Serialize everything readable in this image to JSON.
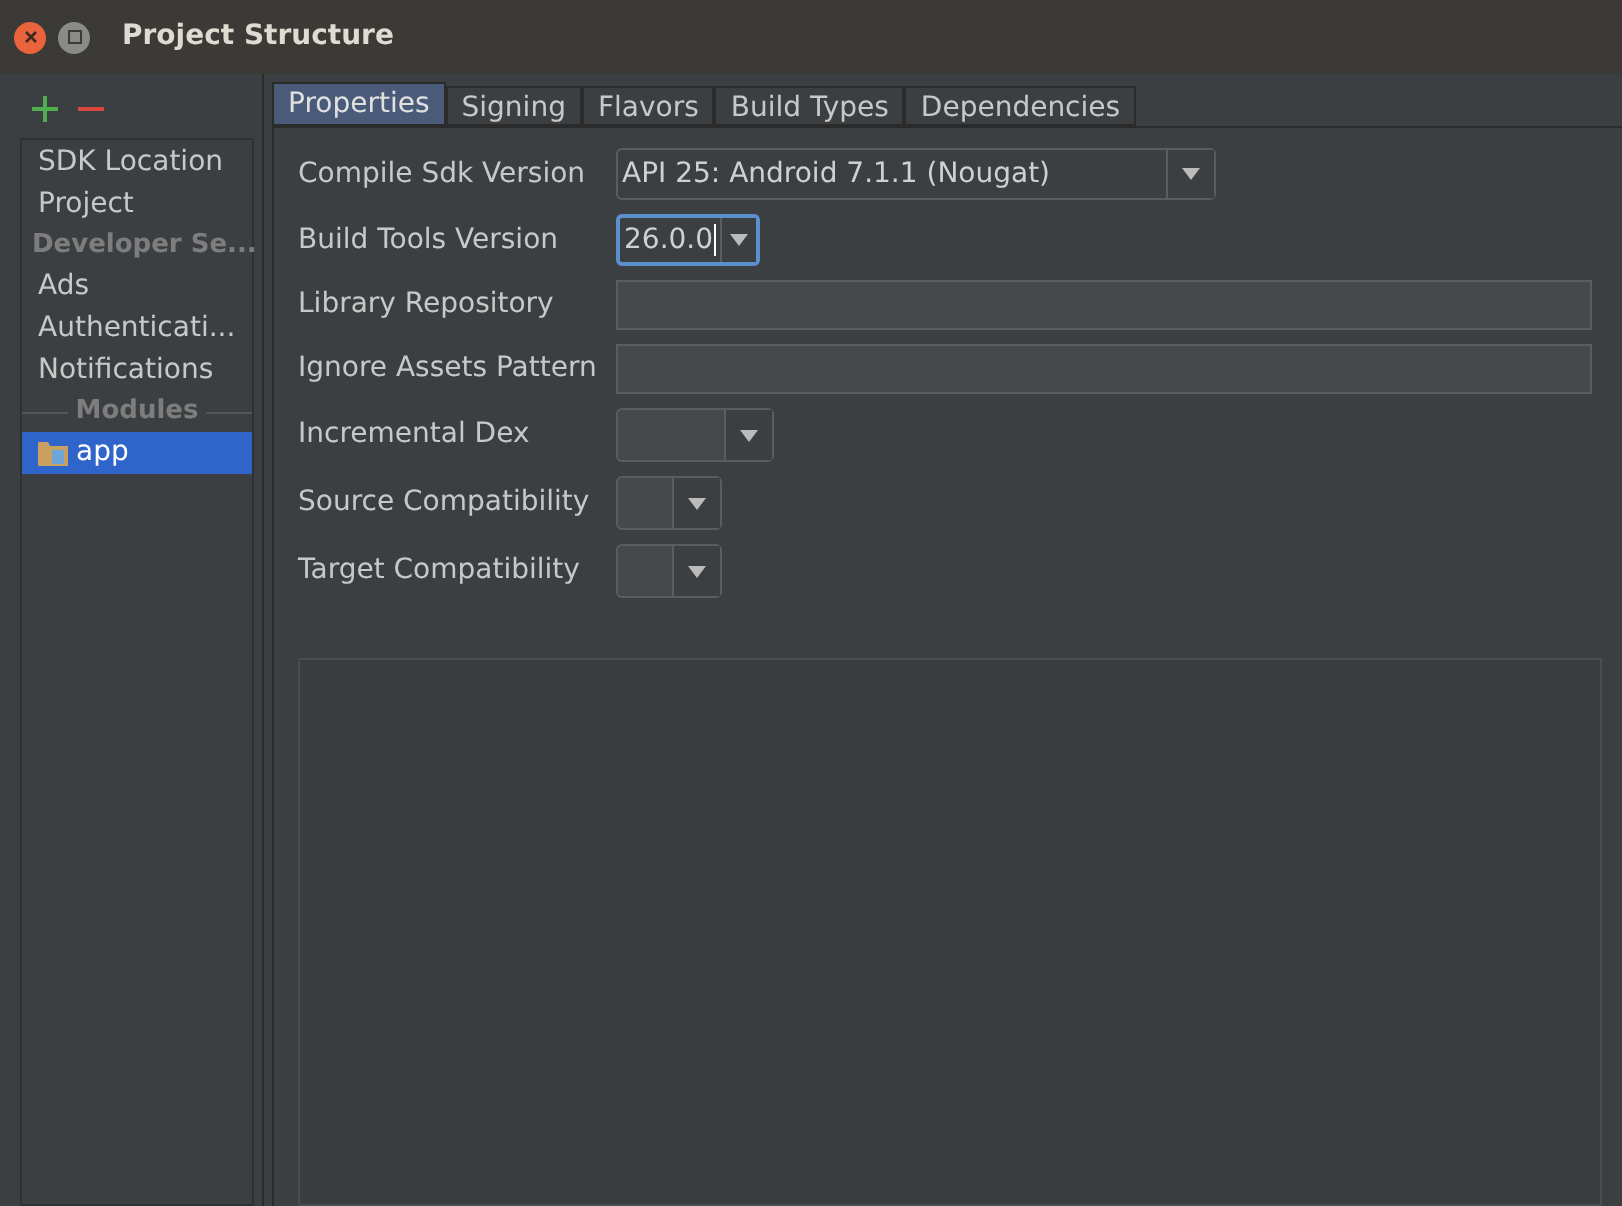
{
  "window": {
    "title": "Project Structure"
  },
  "sidebar": {
    "items": [
      {
        "kind": "item",
        "label": "SDK Location",
        "selected": false
      },
      {
        "kind": "item",
        "label": "Project",
        "selected": false
      },
      {
        "kind": "header",
        "label": "Developer Se..."
      },
      {
        "kind": "item",
        "label": "Ads",
        "selected": false
      },
      {
        "kind": "item",
        "label": "Authenticati...",
        "selected": false
      },
      {
        "kind": "item",
        "label": "Notifications",
        "selected": false
      },
      {
        "kind": "section",
        "label": "Modules"
      },
      {
        "kind": "module",
        "label": "app",
        "selected": true
      }
    ]
  },
  "tabs": [
    {
      "label": "Properties",
      "selected": true
    },
    {
      "label": "Signing",
      "selected": false
    },
    {
      "label": "Flavors",
      "selected": false
    },
    {
      "label": "Build Types",
      "selected": false
    },
    {
      "label": "Dependencies",
      "selected": false
    }
  ],
  "properties": [
    {
      "label": "Compile Sdk Version",
      "kind": "dropdown",
      "value": "API 25: Android 7.1.1 (Nougat)",
      "focused": false
    },
    {
      "label": "Build Tools Version",
      "kind": "dropdown",
      "value": "26.0.0",
      "focused": true
    },
    {
      "label": "Library Repository",
      "kind": "text",
      "focused": false
    },
    {
      "label": "Ignore Assets Pattern",
      "kind": "text",
      "focused": false
    },
    {
      "label": "Incremental Dex",
      "kind": "dropdown",
      "focused": false
    },
    {
      "label": "Source Compatibility",
      "kind": "dropdown",
      "focused": false
    },
    {
      "label": "Target Compatibility",
      "kind": "dropdown",
      "focused": false
    }
  ]
}
